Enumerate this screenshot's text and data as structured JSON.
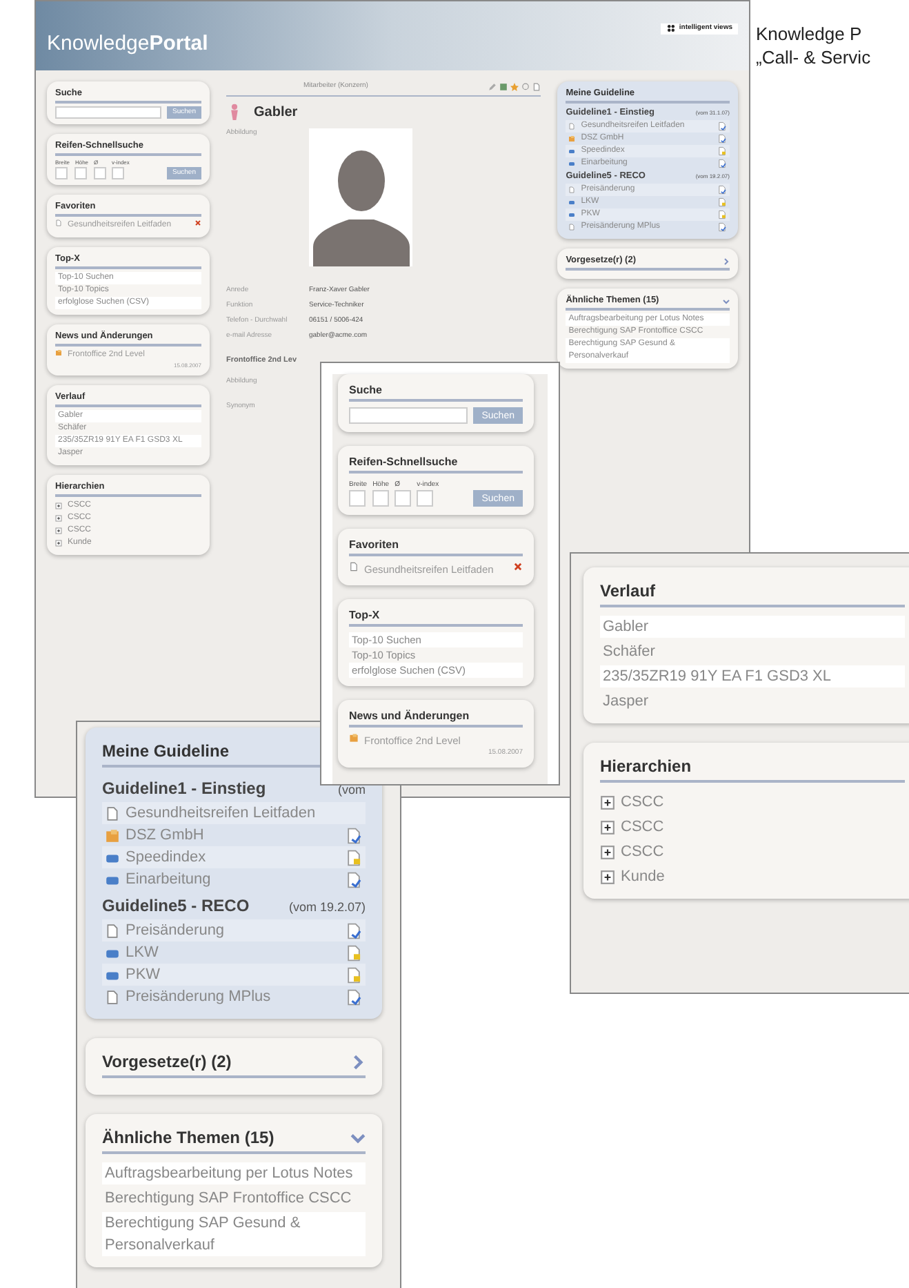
{
  "caption": [
    "Knowledge P",
    "„Call- & Servic"
  ],
  "main": {
    "logo": "Knowledge**Portal**",
    "brand": "intelligent views",
    "left_panels": [
      {
        "kind": "search",
        "title": "Suche",
        "button": "Suchen"
      },
      {
        "kind": "tire_search",
        "title": "Reifen-Schnellsuche",
        "labels": [
          "Breite",
          "Höhe",
          "Ø",
          "v-index"
        ],
        "button": "Suchen"
      },
      {
        "kind": "favorites",
        "title": "Favoriten",
        "items": [
          "Gesundheitsreifen Leitfaden"
        ]
      },
      {
        "kind": "list",
        "title": "Top-X",
        "items": [
          "Top-10 Suchen",
          "Top-10 Topics",
          "erfolglose Suchen (CSV)"
        ]
      },
      {
        "kind": "news",
        "title": "News und Änderungen",
        "items": [
          "Frontoffice 2nd Level"
        ],
        "date": "15.08.2007"
      },
      {
        "kind": "list",
        "title": "Verlauf",
        "items": [
          "Gabler",
          "Schäfer",
          "235/35ZR19 91Y EA F1 GSD3 XL",
          "Jasper"
        ]
      },
      {
        "kind": "tree",
        "title": "Hierarchien",
        "items": [
          {
            "label": "CSCC",
            "expanded": false
          },
          {
            "label": "CSCC",
            "expanded": false
          },
          {
            "label": "CSCC",
            "expanded": false
          },
          {
            "label": "Kunde",
            "expanded": false
          }
        ]
      }
    ],
    "record": {
      "type": "Mitarbeiter (Konzern)",
      "name": "Gabler",
      "image_label": "Abbildung",
      "fields": [
        {
          "label": "Anrede",
          "value": "Franz-Xaver Gabler"
        },
        {
          "label": "Funktion",
          "value": "Service-Techniker"
        },
        {
          "label": "Telefon - Durchwahl",
          "value": "06151 / 5006-424"
        },
        {
          "label": "e-mail Adresse",
          "value": "gabler@acme.com"
        }
      ],
      "section": "Frontoffice 2nd Lev",
      "section_fields": [
        "Abbildung",
        "Synonym"
      ]
    },
    "right_panels": [
      {
        "kind": "guideline",
        "title": "Meine Guideline",
        "groups": [
          {
            "title": "Guideline1 - Einstieg",
            "date": "(vom 31.1.07)",
            "items": [
              {
                "label": "Gesundheitsreifen Leitfaden",
                "kind": "document",
                "locked": false
              },
              {
                "label": "DSZ GmbH",
                "kind": "organization",
                "locked": false
              },
              {
                "label": "Speedindex",
                "kind": "topic",
                "locked": true
              },
              {
                "label": "Einarbeitung",
                "kind": "topic",
                "locked": false
              }
            ]
          },
          {
            "title": "Guideline5 - RECO",
            "date": "(vom 19.2.07)",
            "items": [
              {
                "label": "Preisänderung",
                "kind": "document",
                "locked": false
              },
              {
                "label": "LKW",
                "kind": "topic",
                "locked": true
              },
              {
                "label": "PKW",
                "kind": "topic",
                "locked": true
              },
              {
                "label": "Preisänderung MPlus",
                "kind": "document",
                "locked": false
              }
            ]
          }
        ]
      },
      {
        "kind": "section",
        "title": "Vorgesetze(r) (2)",
        "expanded": false
      },
      {
        "kind": "section",
        "title": "Ähnliche Themen (15)",
        "expanded": true,
        "items": [
          "Auftragsbearbeitung per Lotus Notes",
          "Berechtigung SAP Frontoffice CSCC",
          "Berechtigung SAP Gesund & Personalverkauf"
        ]
      }
    ]
  },
  "zoom_guideline": [
    {
      "kind": "guideline",
      "title": "Meine Guideline",
      "groups": [
        {
          "title": "Guideline1 - Einstieg",
          "date": "(vom",
          "items": [
            {
              "label": "Gesundheitsreifen Leitfaden",
              "kind": "document"
            },
            {
              "label": "DSZ GmbH",
              "kind": "organization",
              "locked": false
            },
            {
              "label": "Speedindex",
              "kind": "topic",
              "locked": true
            },
            {
              "label": "Einarbeitung",
              "kind": "topic",
              "locked": false
            }
          ]
        },
        {
          "title": "Guideline5 - RECO",
          "date": "(vom 19.2.07)",
          "items": [
            {
              "label": "Preisänderung",
              "kind": "document",
              "locked": false
            },
            {
              "label": "LKW",
              "kind": "topic",
              "locked": true
            },
            {
              "label": "PKW",
              "kind": "topic",
              "locked": true
            },
            {
              "label": "Preisänderung MPlus",
              "kind": "document",
              "locked": false
            }
          ]
        }
      ]
    },
    {
      "kind": "section",
      "title": "Vorgesetze(r) (2)",
      "expanded": false
    },
    {
      "kind": "section",
      "title": "Ähnliche Themen (15)",
      "expanded": true,
      "items": [
        "Auftragsbearbeitung per Lotus Notes",
        "Berechtigung SAP Frontoffice CSCC",
        "Berechtigung SAP Gesund & Personalverkauf"
      ]
    }
  ],
  "zoom_left": [
    {
      "kind": "search",
      "title": "Suche",
      "button": "Suchen"
    },
    {
      "kind": "tire_search",
      "title": "Reifen-Schnellsuche",
      "labels": [
        "Breite",
        "Höhe",
        "Ø",
        "v-index"
      ],
      "button": "Suchen"
    },
    {
      "kind": "favorites",
      "title": "Favoriten",
      "items": [
        "Gesundheitsreifen Leitfaden"
      ]
    },
    {
      "kind": "list",
      "title": "Top-X",
      "items": [
        "Top-10 Suchen",
        "Top-10 Topics",
        "erfolglose Suchen (CSV)"
      ]
    },
    {
      "kind": "news",
      "title": "News und Änderungen",
      "items": [
        "Frontoffice 2nd Level"
      ],
      "date": "15.08.2007"
    }
  ],
  "zoom_history": [
    {
      "kind": "list",
      "title": "Verlauf",
      "items": [
        "Gabler",
        "Schäfer",
        "235/35ZR19 91Y EA F1 GSD3 XL",
        "Jasper"
      ]
    },
    {
      "kind": "tree",
      "title": "Hierarchien",
      "items": [
        {
          "label": "CSCC",
          "expanded": false
        },
        {
          "label": "CSCC",
          "expanded": false
        },
        {
          "label": "CSCC",
          "expanded": false
        },
        {
          "label": "Kunde",
          "expanded": false
        }
      ]
    }
  ]
}
